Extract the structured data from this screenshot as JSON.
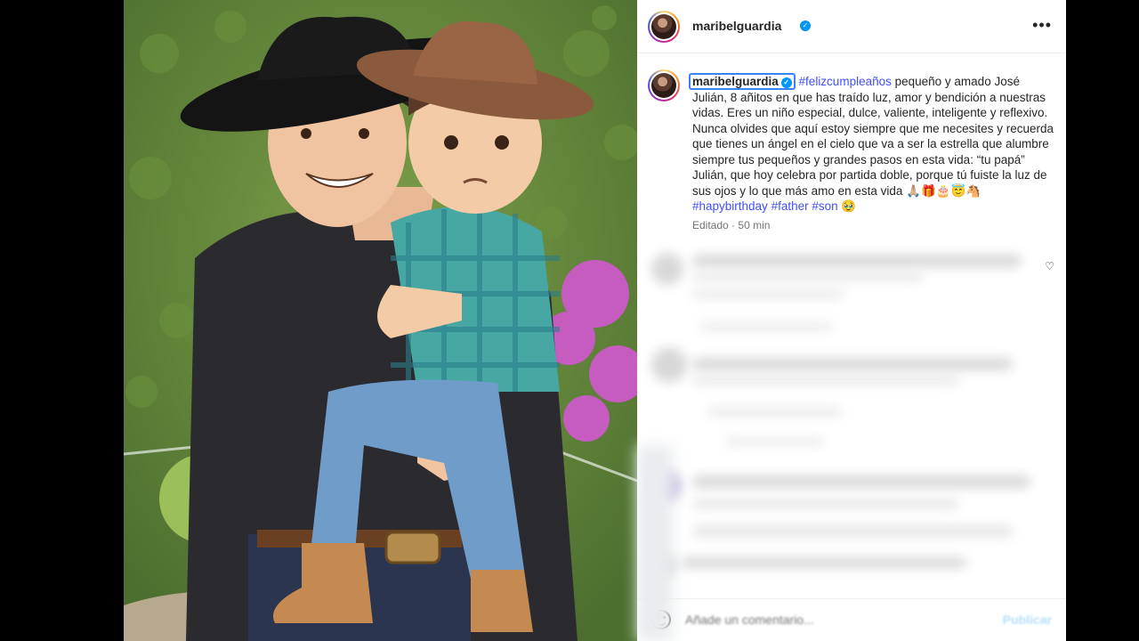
{
  "post": {
    "username": "maribelguardia",
    "verified": true,
    "more_icon": "more-horizontal-icon"
  },
  "caption": {
    "username": "maribelguardia",
    "hashtag_lead": "#felizcumpleaños",
    "text": " pequeño y amado José Julián, 8 añitos en que has traído luz, amor y bendición a nuestras vidas. Eres un niño especial, dulce, valiente, inteligente y reflexivo. Nunca olvides que aquí estoy siempre que me necesites y recuerda que tienes un ángel en el cielo que va a ser la estrella que alumbre siempre tus pequeños y grandes pasos en esta vida: “tu papá” Julián, que hoy celebra por partida doble, porque tú fuiste la luz de sus ojos y lo que más amo en esta vida ",
    "emojis": "🙏🏼🎁🎂😇🐴",
    "hashtags": [
      "#hapybirthday",
      "#father",
      "#son"
    ],
    "trailing_emoji": "🥹",
    "edited_label": "Editado",
    "separator": "·",
    "time_ago": "50 min"
  },
  "comment_bar": {
    "placeholder": "Añade un comentario...",
    "publish_label": "Publicar"
  },
  "colors": {
    "link": "#4150f7",
    "verified": "#0095f6",
    "publish_disabled": "#b2dffc"
  }
}
